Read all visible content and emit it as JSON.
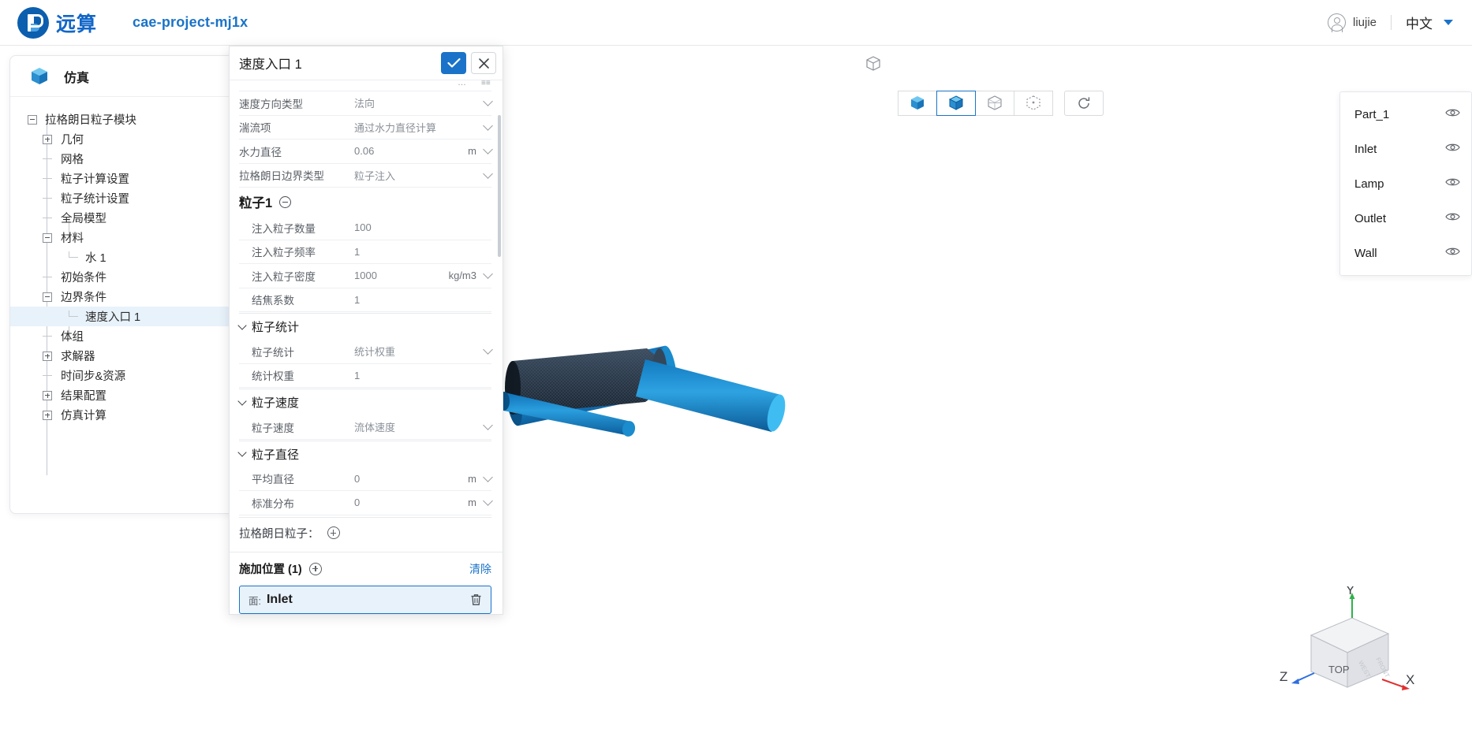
{
  "header": {
    "brand": "远算",
    "project": "cae-project-mj1x",
    "user": "liujie",
    "lang": "中文"
  },
  "tree_panel": {
    "title": "仿真",
    "nodes": [
      {
        "label": "拉格朗日粒子模块",
        "toggle": "minus",
        "depth": 0,
        "icon": "info"
      },
      {
        "label": "几何",
        "toggle": "plus",
        "depth": 1,
        "icon": ""
      },
      {
        "label": "网格",
        "toggle": "stub",
        "depth": 1,
        "icon": ""
      },
      {
        "label": "粒子计算设置",
        "toggle": "stub",
        "depth": 1,
        "icon": ""
      },
      {
        "label": "粒子统计设置",
        "toggle": "stub",
        "depth": 1,
        "icon": ""
      },
      {
        "label": "全局模型",
        "toggle": "stub",
        "depth": 1,
        "icon": ""
      },
      {
        "label": "材料",
        "toggle": "minus",
        "depth": 1,
        "icon": ""
      },
      {
        "label": "水 1",
        "toggle": "corner",
        "depth": 2,
        "icon": "lines"
      },
      {
        "label": "初始条件",
        "toggle": "stub",
        "depth": 1,
        "icon": ""
      },
      {
        "label": "边界条件",
        "toggle": "minus",
        "depth": 1,
        "icon": "plus"
      },
      {
        "label": "速度入口 1",
        "toggle": "corner",
        "depth": 2,
        "icon": "lines",
        "selected": true
      },
      {
        "label": "体组",
        "toggle": "stub",
        "depth": 1,
        "icon": "plus"
      },
      {
        "label": "求解器",
        "toggle": "plus",
        "depth": 1,
        "icon": ""
      },
      {
        "label": "时间步&资源",
        "toggle": "stub",
        "depth": 1,
        "icon": ""
      },
      {
        "label": "结果配置",
        "toggle": "plus",
        "depth": 1,
        "icon": ""
      },
      {
        "label": "仿真计算",
        "toggle": "plus",
        "depth": 1,
        "icon": ""
      }
    ]
  },
  "dialog": {
    "title": "速度入口 1",
    "rows_top": [
      {
        "label": "速度方向类型",
        "value": "法向",
        "type": "select"
      },
      {
        "label": "湍流项",
        "value": "通过水力直径计算",
        "type": "select"
      },
      {
        "label": "水力直径",
        "value": "0.06",
        "type": "input",
        "unit": "m"
      },
      {
        "label": "拉格朗日边界类型",
        "value": "粒子注入",
        "type": "select"
      }
    ],
    "particle_section": {
      "title": "粒子1",
      "rows": [
        {
          "label": "注入粒子数量",
          "value": "100",
          "type": "input"
        },
        {
          "label": "注入粒子频率",
          "value": "1",
          "type": "input"
        },
        {
          "label": "注入粒子密度",
          "value": "1000",
          "type": "input",
          "unit": "kg/m3"
        },
        {
          "label": "结焦系数",
          "value": "1",
          "type": "input"
        }
      ]
    },
    "groups": [
      {
        "title": "粒子统计",
        "rows": [
          {
            "label": "粒子统计",
            "value": "统计权重",
            "type": "select"
          },
          {
            "label": "统计权重",
            "value": "1",
            "type": "input"
          }
        ]
      },
      {
        "title": "粒子速度",
        "rows": [
          {
            "label": "粒子速度",
            "value": "流体速度",
            "type": "select"
          }
        ]
      },
      {
        "title": "粒子直径",
        "rows": [
          {
            "label": "平均直径",
            "value": "0",
            "type": "input",
            "unit": "m"
          },
          {
            "label": "标准分布",
            "value": "0",
            "type": "input",
            "unit": "m"
          }
        ]
      }
    ],
    "lagrangian_particles_label": "拉格朗日粒子：",
    "footer": {
      "title": "施加位置 (1)",
      "clear": "清除",
      "selection_kind": "面:",
      "selection_value": "Inlet"
    }
  },
  "right_list": {
    "items": [
      {
        "label": "Part_1"
      },
      {
        "label": "Inlet"
      },
      {
        "label": "Lamp"
      },
      {
        "label": "Outlet"
      },
      {
        "label": "Wall"
      }
    ]
  },
  "axis_widget": {
    "x": "X",
    "y": "Y",
    "z": "Z",
    "face": "TOP"
  },
  "colors": {
    "accent": "#1a73c8",
    "brand": "#1266c7",
    "selection_bg": "#e8f2fb",
    "geom_blue": "#1f8fd6",
    "geom_dark": "#2b3a4a"
  }
}
